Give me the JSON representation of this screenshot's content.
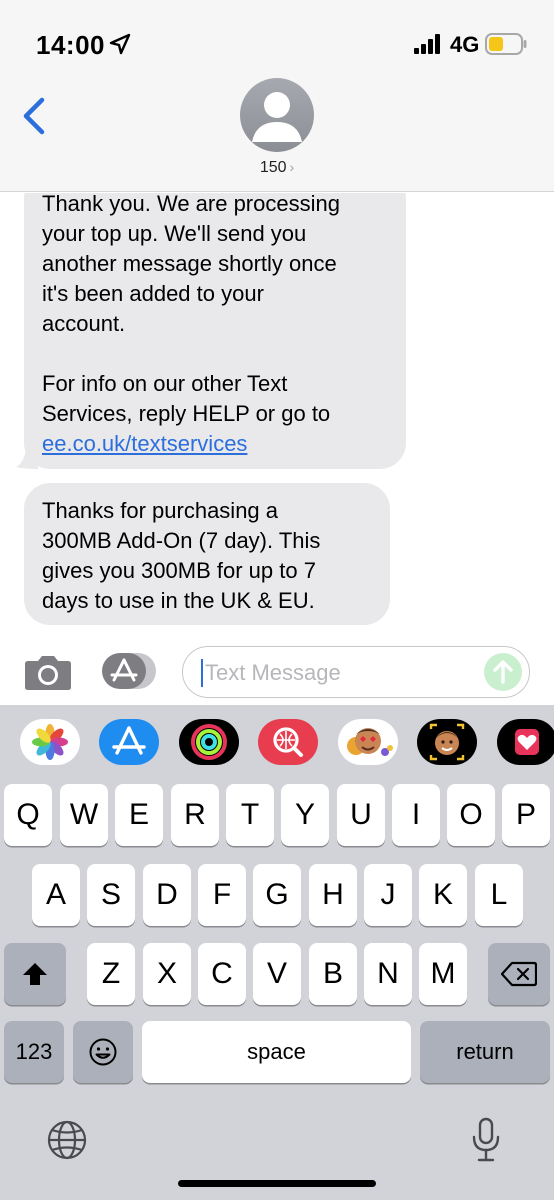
{
  "status_bar": {
    "time": "14:00",
    "network": "4G",
    "battery_level": 0.45,
    "battery_color": "#f5c518"
  },
  "header": {
    "contact_name": "150",
    "back_icon": "chevron-left-icon",
    "avatar_icon": "person-silhouette-icon"
  },
  "messages": [
    {
      "sender": "them",
      "paragraphs": [
        [
          "Thank you. We are processing",
          "your top up. We'll send you",
          "another message shortly once",
          "it's been added to your",
          "account."
        ],
        [
          "For info on our other Text",
          "Services, reply HELP or go to"
        ]
      ],
      "link": "ee.co.uk/textservices"
    },
    {
      "sender": "them",
      "paragraphs": [
        [
          "Thanks for purchasing a",
          "300MB Add-On (7 day). This",
          "gives you 300MB for up to 7",
          "days to use in the UK & EU."
        ]
      ]
    }
  ],
  "input": {
    "placeholder": "Text Message",
    "send_icon": "arrow-up-icon"
  },
  "app_drawer": [
    "photos-app-icon",
    "app-store-app-icon",
    "activity-app-icon",
    "image-search-app-icon",
    "memoji-stickers-app-icon",
    "memoji-camera-app-icon",
    "heart-app-icon"
  ],
  "keyboard": {
    "row1": [
      "Q",
      "W",
      "E",
      "R",
      "T",
      "Y",
      "U",
      "I",
      "O",
      "P"
    ],
    "row2": [
      "A",
      "S",
      "D",
      "F",
      "G",
      "H",
      "J",
      "K",
      "L"
    ],
    "row3": [
      "Z",
      "X",
      "C",
      "V",
      "B",
      "N",
      "M"
    ],
    "numbers_label": "123",
    "space_label": "space",
    "return_label": "return"
  },
  "colors": {
    "accent": "#2c6fdc",
    "bubble_gray": "#e9e9eb",
    "keyboard_bg": "#d1d3d9",
    "send_disabled": "#c9efce"
  }
}
